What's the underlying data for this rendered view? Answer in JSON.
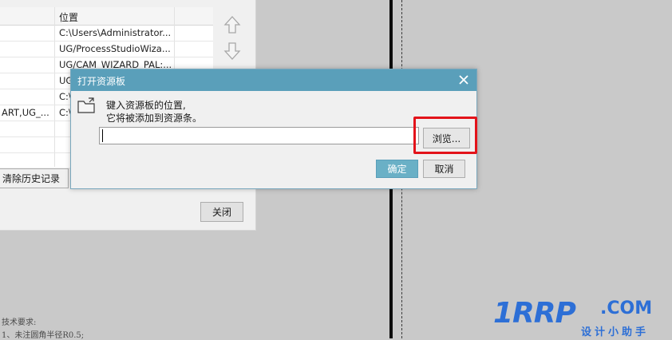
{
  "background_panel": {
    "table": {
      "header": {
        "col2": "位置"
      },
      "rows": [
        {
          "col1": "",
          "col2": "C:\\Users\\Administrator..."
        },
        {
          "col1": "",
          "col2": "UG/ProcessStudioWiza..."
        },
        {
          "col1": "",
          "col2": "UG/CAM_WIZARD_PAL:..."
        },
        {
          "col1": "",
          "col2": "UG"
        },
        {
          "col1": "",
          "col2": "C:\\"
        },
        {
          "col1": "ART,UG_...",
          "col2": "C:\\"
        },
        {
          "col1": "",
          "col2": ""
        },
        {
          "col1": "",
          "col2": ""
        },
        {
          "col1": "",
          "col2": ""
        }
      ]
    },
    "clear_history_label": "清除历史记录",
    "close_label": "关闭",
    "icons": {
      "up": "arrow-up-icon",
      "down": "arrow-down-icon"
    }
  },
  "drawing_notes": [
    "技术要求:",
    "1、未注圆角半径R0.5;"
  ],
  "dialog": {
    "title": "打开资源板",
    "prompt_line1": "键入资源板的位置,",
    "prompt_line2": "它将被添加到资源条。",
    "input_value": "",
    "browse_label": "浏览...",
    "ok_label": "确定",
    "cancel_label": "取消",
    "icons": {
      "close": "close-icon",
      "folder": "folder-open-icon"
    }
  },
  "watermark": {
    "main": "1RRP",
    "domain": ".COM",
    "sub": "设计小助手"
  },
  "colors": {
    "title_bar": "#5a9fba",
    "highlight": "#e3131a",
    "watermark": "#2d6fd6",
    "ok_button": "#6ab0c6"
  }
}
